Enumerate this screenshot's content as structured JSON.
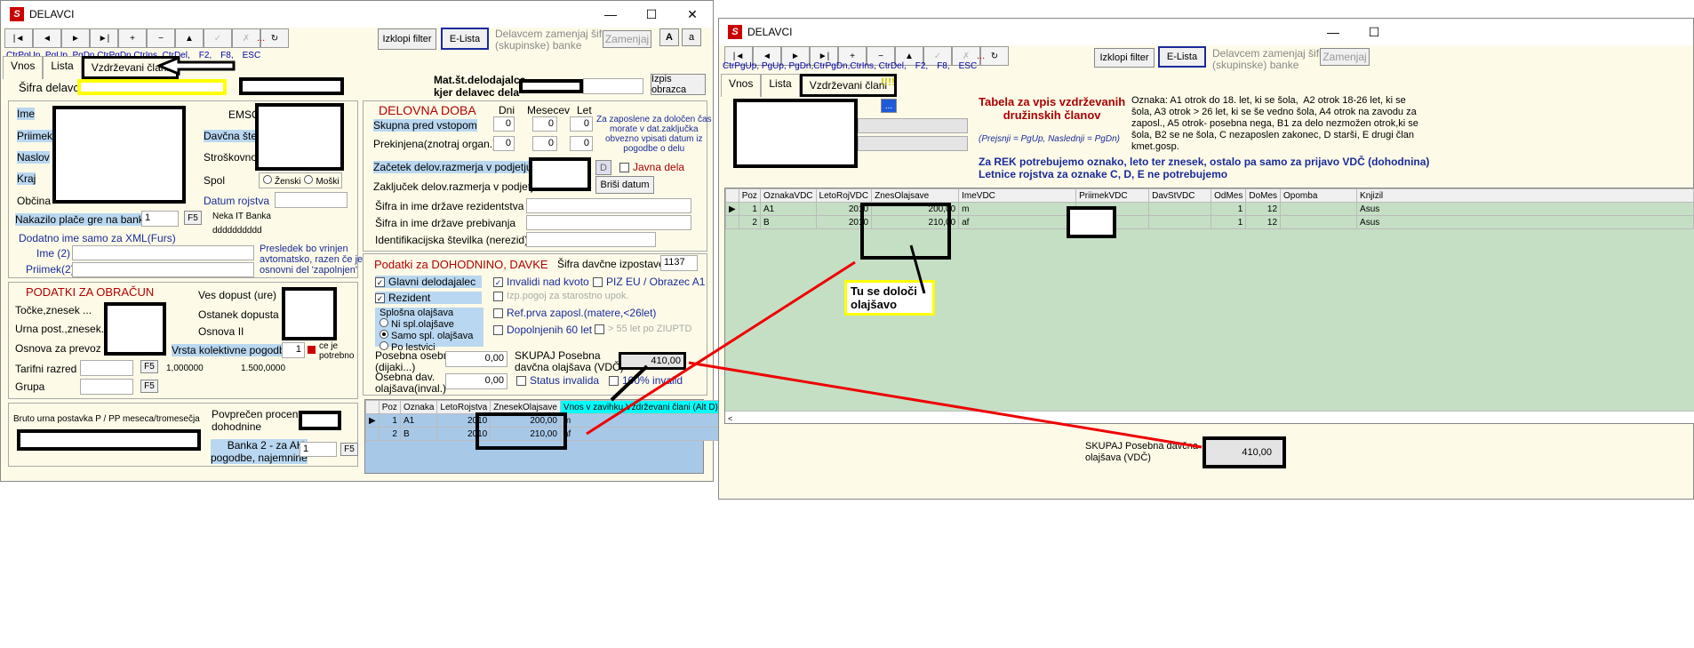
{
  "left": {
    "title": "DELAVCI",
    "hotkeys": [
      "CtrPgUp, PgUp, PgDn,CtrPgDn,CtrIns, CtrDel,",
      "F2,",
      "F8,",
      "ESC"
    ],
    "toolbar": [
      "|◄",
      "◄",
      "►",
      "►|",
      "+",
      "−",
      "▲",
      "✓",
      "✗",
      "↻"
    ],
    "dots": "...",
    "izklopi": "Izklopi filter",
    "elista": "E-Lista",
    "delavcem": "Delavcem zamenjaj šifro\n(skupinske) banke",
    "zamenjaj": "Zamenjaj",
    "a_big": "A",
    "a_small": "a",
    "tabs": [
      "Vnos",
      "Lista",
      "Vzdrževani člani"
    ],
    "sifra_delavca": "Šifra delavca",
    "mat_st": "Mat.št.delodajalca\nkjer delavec dela",
    "izpis": "Izpis obrazca",
    "fields": {
      "ime": "Ime",
      "priimek": "Priimek",
      "naslov": "Naslov",
      "kraj": "Kraj",
      "obcina": "Občina",
      "emso": "EMSO",
      "davcna": "Davčna števil",
      "strosk": "Stroškovno m",
      "spol": "Spol",
      "zenski": "Ženski",
      "moski": "Moški",
      "datum_rojstva": "Datum rojstva"
    },
    "nakazilo": "Nakazilo plače gre na banko:",
    "nakazilo_val": "1",
    "f5": "F5",
    "neka_banka": "Neka IT Banka",
    "ddd": "dddddddddd",
    "dodatno": "Dodatno ime samo za XML(Furs)",
    "ime2": "Ime (2)",
    "priimek2": "Priimek(2)",
    "presledek": "Presledek bo vrinjen\navtomatsko, razen če je\nosnovni del 'zapolnjen'",
    "podatki_obracun": "PODATKI ZA OBRAČUN",
    "tocke": "Točke,znesek ...",
    "urna": "Urna post.,znesek. ...",
    "osnova_prevoz": "Osnova za prevoz",
    "tarifni": "Tarifni razred",
    "grupa": "Grupa",
    "ves_dopust": "Ves dopust (ure)",
    "ostanek": "Ostanek dopusta",
    "osnova2": "Osnova II",
    "vrsta_kol": "Vrsta kolektivne pogodbe",
    "vrsta_val": "1",
    "ce_je": "ce je\npotrebno",
    "v1000": "1,000000",
    "v1500": "1.500,0000",
    "bruto": "Bruto urna postavka P / PP meseca/tromesečja",
    "povprecen": "Povprečen procent\ndohodnine",
    "banka2": "Banka 2 - za AH,\npogodbe, najemnine",
    "banka2_val": "1",
    "delovna_doba": "DELOVNA DOBA",
    "dni": "Dni",
    "mesecev": "Mesecev",
    "let": "Let",
    "skupna": "Skupna pred vstopom",
    "prekinjena": "Prekinjena(znotraj organ.)",
    "zeros": [
      "0",
      "0",
      "0"
    ],
    "za_zaposlene": "Za zaposlene za določen čas\nmorate v dat.zaključka\nobvezno vpisati datum iz\npogodbe o delu",
    "zacetek": "Začetek delov.razmerja v podjetju",
    "zakljucek": "Zaključek delov.razmerja v podjetju",
    "javna": "Javna dela",
    "brisi": "Briši datum",
    "d_btn": "D",
    "sifra_rezid": "Šifra in ime države rezidentstva",
    "sifra_preb": "Šifra in ime države prebivanja",
    "identif": "Identifikacijska številka (nerezid)",
    "dohodnino": "Podatki za DOHODNINO, DAVKE",
    "sifra_dav": "Šifra davčne izpostave",
    "sifra_dav_val": "1137",
    "glavni": "Glavni delodajalec",
    "rezident": "Rezident",
    "invalidi": "Invalidi nad kvoto",
    "piz": "PIZ EU / Obrazec A1",
    "izp_pogoj": "Izp.pogoj za starostno upok.",
    "splosna": "Splošna olajšava",
    "ni_spl": "Ni spl.olajšave",
    "samo_spl": "Samo spl. olajšava",
    "po_lestvici": "Po lestvici",
    "ref_prva": "Ref.prva zaposl.(matere,<26let)",
    "dopolnjenih": "Dopolnjenih 60 let",
    "nad55": "> 55 let po  ZIUPTD",
    "posebna": "Posebna osebna\n(dijaki...)",
    "osebna_dav": "Osebna dav.\nolajšava(inval.)",
    "zero_dec": "0,00",
    "skupaj_pos": "SKUPAJ Posebna\ndavčna olajšava (VDČ)",
    "skupaj_val": "410,00",
    "status_inv": "Status invalida",
    "inv100": "100% invalid",
    "grid_headers": [
      "Poz",
      "Oznaka",
      "LetoRojstva",
      "ZnesekOlajsave",
      "Vnos v zavihku Vzdrževani člani (Alt D)"
    ],
    "grid_rows": [
      [
        "1",
        "A1",
        "2010",
        "200,00",
        "m"
      ],
      [
        "2",
        "B",
        "2010",
        "210,00",
        "af"
      ]
    ]
  },
  "right": {
    "title": "DELAVCI",
    "hotkeys": [
      "CtrPgUp, PgUp, PgDn,CtrPgDn,CtrIns, CtrDel,",
      "F2,",
      "F8,",
      "ESC"
    ],
    "dots": "...",
    "izklopi": "Izklopi filter",
    "elista": "E-Lista",
    "delavcem": "Delavcem zamenjaj šifro\n(skupinske) banke",
    "zamenjaj": "Zamenjaj",
    "tabs": [
      "Vnos",
      "Lista",
      "Vzdrževani člani"
    ],
    "excl": "!!!!",
    "dots_btn": "...",
    "tabela_title": "Tabela za vpis vzdrževanih\ndružinskih članov",
    "prejsnji": "(Prejsnji = PgUp, Naslednji = PgDn)",
    "oznaka_text": "Oznaka: A1 otrok do 18. let, ki se šola,  A2 otrok 18-26 let, ki se\nšola, A3 otrok > 26 let, ki se še vedno šola, A4 otrok na zavodu za\nzaposl., A5 otrok- posebna nega, B1 za delo nezmožen otrok,ki se\nšola, B2 se ne šola, C nezaposlen zakonec, D starši, E drugi član\nkmet.gosp.",
    "za_rek": "Za REK potrebujemo oznako, leto ter znesek, ostalo pa samo za prijavo VDČ (dohodnina)\nLetnice rojstva za oznake C, D, E ne potrebujemo",
    "grid_headers": [
      "Poz",
      "OznakaVDC",
      "LetoRojVDC",
      "ZnesOlajsave",
      "ImeVDC",
      "PriimekVDC",
      "DavStVDC",
      "OdMes",
      "DoMes",
      "Opomba",
      "Knjizil"
    ],
    "grid_rows": [
      [
        "1",
        "A1",
        "2010",
        "200,00",
        "m",
        "",
        "",
        "1",
        "12",
        "",
        "Asus"
      ],
      [
        "2",
        "B",
        "2010",
        "210,00",
        "af",
        "",
        "",
        "1",
        "12",
        "",
        "Asus"
      ]
    ],
    "skupaj": "SKUPAJ Posebna davčna\nolajšava (VDČ)",
    "skupaj_val": "410,00"
  },
  "annotation": "Tu se določi\nolajšavo"
}
